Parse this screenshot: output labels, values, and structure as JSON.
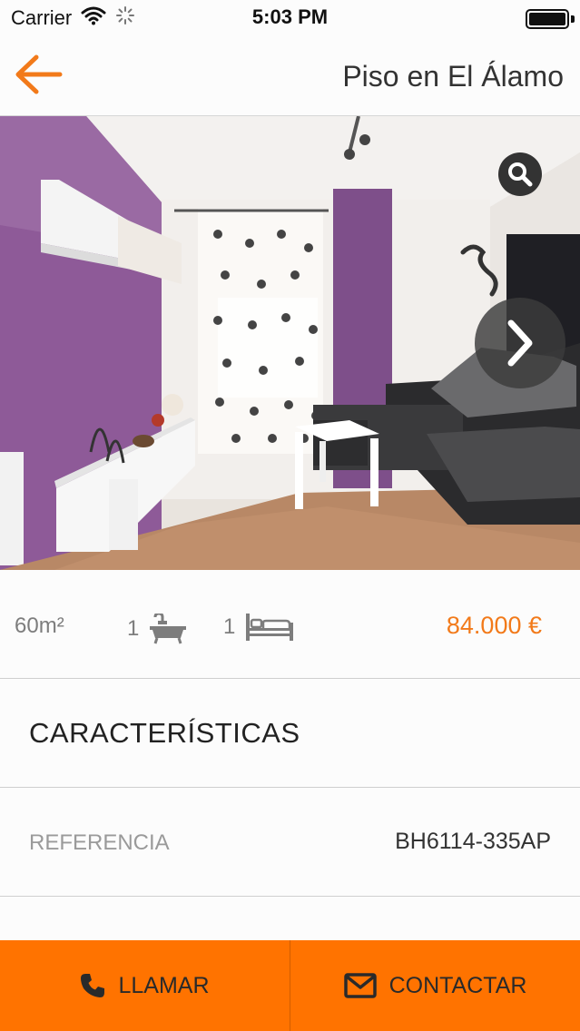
{
  "status_bar": {
    "carrier": "Carrier",
    "time": "5:03 PM"
  },
  "nav": {
    "title": "Piso en El Álamo",
    "back_icon": "arrow-left-icon"
  },
  "photo": {
    "zoom_icon": "magnifier-icon",
    "next_icon": "chevron-right-icon"
  },
  "specs": {
    "area": "60m²",
    "bathrooms": "1",
    "bathroom_icon": "bathtub-icon",
    "bedrooms": "1",
    "bedroom_icon": "bed-icon",
    "price": "84.000 €"
  },
  "features": {
    "title": "CARACTERÍSTICAS",
    "reference_label": "REFERENCIA",
    "reference_value": "BH6114-335AP"
  },
  "actions": {
    "call_label": "LLAMAR",
    "call_icon": "phone-icon",
    "contact_label": "CONTACTAR",
    "contact_icon": "envelope-icon"
  },
  "colors": {
    "accent": "#F27A1A",
    "action_bar": "#FF7300",
    "purple_wall": "#8E5A98"
  }
}
